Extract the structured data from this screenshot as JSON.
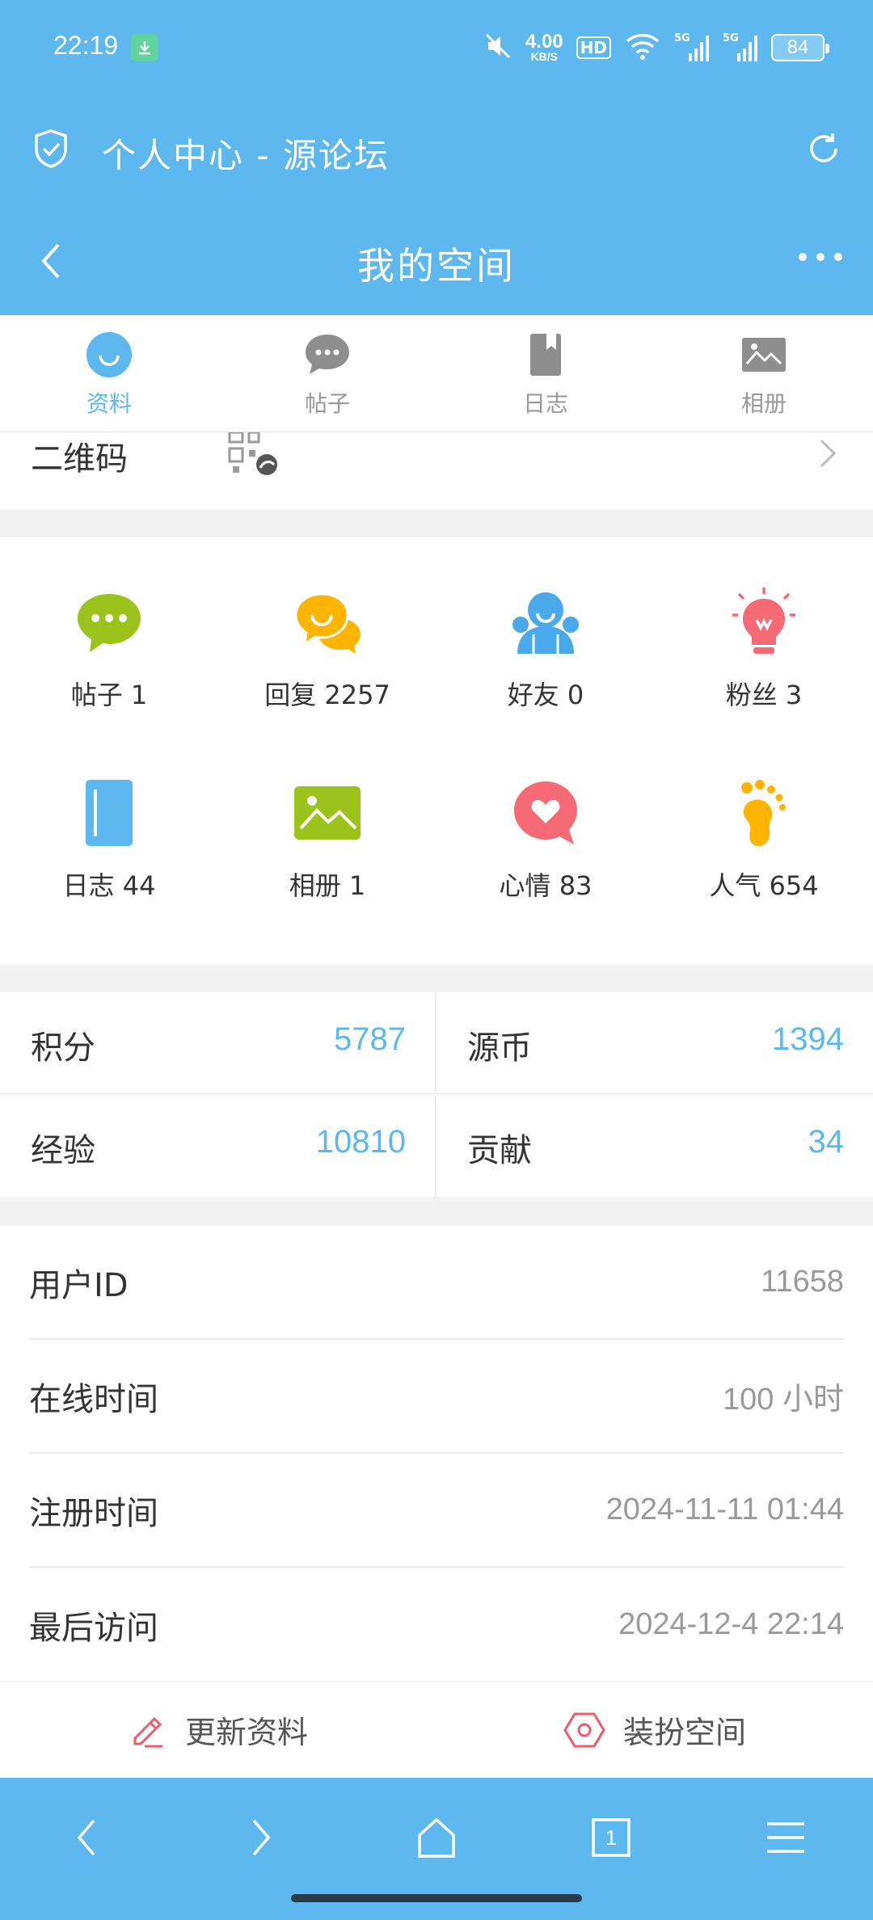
{
  "status_bar": {
    "time": "22:19",
    "net_speed_value": "4.00",
    "net_speed_unit": "KB/S",
    "hd_label": "HD",
    "signal_label_1": "5G",
    "signal_label_2": "5G",
    "battery": "84"
  },
  "title_bar": {
    "title": "个人中心 - 源论坛"
  },
  "nav_bar": {
    "title": "我的空间"
  },
  "tabs": [
    {
      "label": "资料",
      "active": true
    },
    {
      "label": "帖子",
      "active": false
    },
    {
      "label": "日志",
      "active": false
    },
    {
      "label": "相册",
      "active": false
    }
  ],
  "qr_row": {
    "label": "二维码"
  },
  "grid": [
    {
      "label": "帖子 1",
      "icon": "chat-bubble-icon",
      "color": "#9bc31c"
    },
    {
      "label": "回复 2257",
      "icon": "reply-bubbles-icon",
      "color": "#ffb400"
    },
    {
      "label": "好友 0",
      "icon": "friends-icon",
      "color": "#4aa9ea"
    },
    {
      "label": "粉丝 3",
      "icon": "lightbulb-icon",
      "color": "#f56a74"
    },
    {
      "label": "日志 44",
      "icon": "notebook-icon",
      "color": "#5cb8ee"
    },
    {
      "label": "相册 1",
      "icon": "photo-icon",
      "color": "#9bc31c"
    },
    {
      "label": "心情 83",
      "icon": "heart-bubble-icon",
      "color": "#f56a74"
    },
    {
      "label": "人气 654",
      "icon": "footprint-icon",
      "color": "#ffb400"
    }
  ],
  "stats": [
    {
      "key": "积分",
      "value": "5787"
    },
    {
      "key": "源币",
      "value": "1394"
    },
    {
      "key": "经验",
      "value": "10810"
    },
    {
      "key": "贡献",
      "value": "34"
    }
  ],
  "info": [
    {
      "key": "用户ID",
      "value": "11658"
    },
    {
      "key": "在线时间",
      "value": "100 小时"
    },
    {
      "key": "注册时间",
      "value": "2024-11-11 01:44"
    },
    {
      "key": "最后访问",
      "value": "2024-12-4 22:14"
    }
  ],
  "actions": {
    "update_profile": "更新资料",
    "decorate_space": "装扮空间"
  },
  "bottom_bar": {
    "tab_count": "1"
  },
  "colors": {
    "accent": "#5cb8ee",
    "value_blue": "#5cb8ee",
    "muted": "#999999"
  }
}
